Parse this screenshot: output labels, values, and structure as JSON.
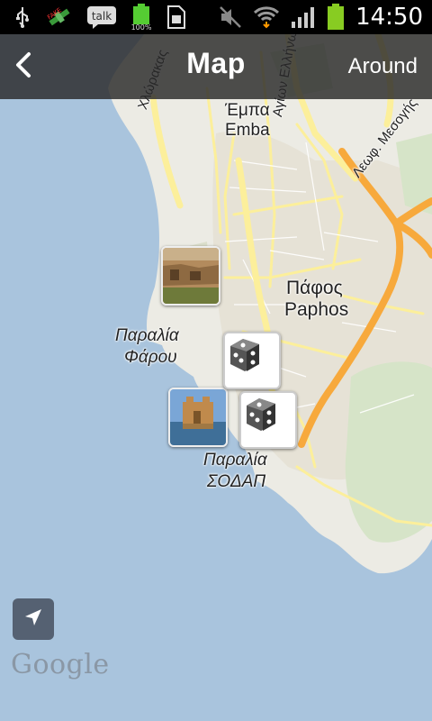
{
  "status_bar": {
    "time": "14:50",
    "battery_percent_label": "100%",
    "talk_label": "talk",
    "icons": [
      "usb-icon",
      "satellite-icon",
      "talk-icon",
      "battery-full-icon",
      "sim-card-icon",
      "mute-icon",
      "wifi-icon",
      "signal-icon",
      "battery-icon"
    ]
  },
  "app_bar": {
    "title": "Map",
    "around_label": "Around",
    "back_icon": "chevron-left-icon"
  },
  "map": {
    "labels": {
      "emba_greek": "Έμπα",
      "emba_latin": "Emba",
      "paphos_greek": "Πάφος",
      "paphos_latin": "Paphos",
      "paralia_farou_1": "Παραλία",
      "paralia_farou_2": "Φάρου",
      "paralia_sodap_1": "Παραλία",
      "paralia_sodap_2": "ΣΟΔΑΠ",
      "road_chlorakas": "Χλώρακας",
      "road_ellinon": "Αγίων Ελλήνων",
      "road_mesogis": "Λεωφ. Μεσογής"
    },
    "markers": [
      "photo",
      "dice",
      "photo",
      "dice"
    ],
    "colors": {
      "sea": "#a9c4dd",
      "land": "#ecebe4",
      "major_road": "#f7a93c",
      "road": "#fcef9b"
    }
  },
  "controls": {
    "locate_icon": "navigation-arrow-icon",
    "google_label": "Google"
  }
}
